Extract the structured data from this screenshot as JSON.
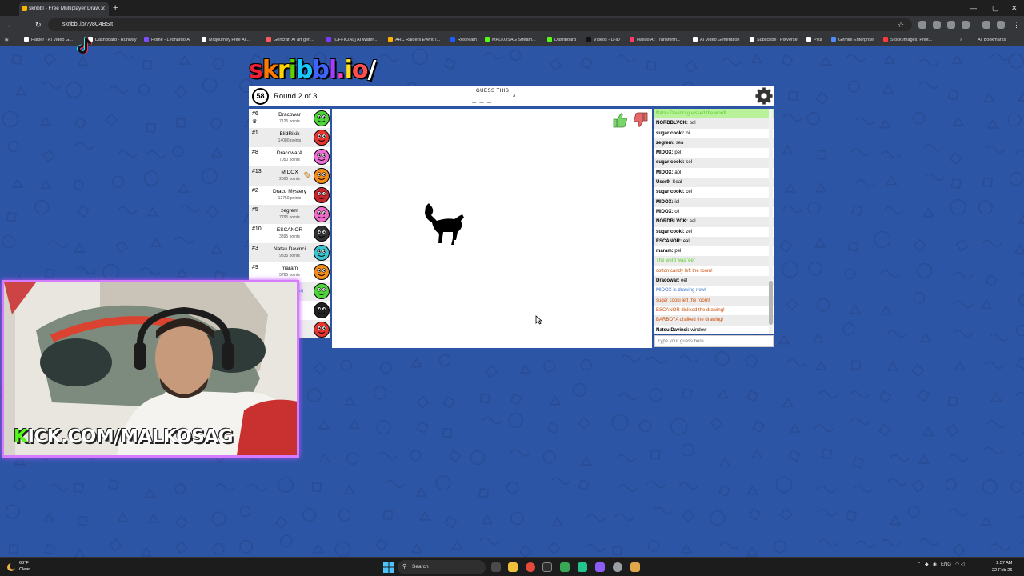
{
  "browser": {
    "tab_title": "skribbl - Free Multiplayer Draw...",
    "url": "skribbl.io/?y8C4BSIt",
    "bookmarks": [
      {
        "label": "Haiper - AI Video G...",
        "color": "#ffffff"
      },
      {
        "label": "Dashboard - Runway",
        "color": "#ffffff"
      },
      {
        "label": "Home - Leonardo.Ai",
        "color": "#7d4cff"
      },
      {
        "label": "Midjourney Free AI...",
        "color": "#ffffff"
      },
      {
        "label": "Gencraft AI art gen...",
        "color": "#ff5a5a"
      },
      {
        "label": "[OFFICIAL] AI Water...",
        "color": "#7a3cff"
      },
      {
        "label": "ARC Raiders Event T...",
        "color": "#ffb300"
      },
      {
        "label": "Restream",
        "color": "#1e5cff"
      },
      {
        "label": "MALKOSAG Stream...",
        "color": "#53fc18"
      },
      {
        "label": "Dashboard",
        "color": "#53fc18"
      },
      {
        "label": "Videos - D-ID",
        "color": "#111111"
      },
      {
        "label": "Hailuo AI: Transform...",
        "color": "#ff3a6b"
      },
      {
        "label": "AI Video Generation",
        "color": "#ffffff"
      },
      {
        "label": "Subscribe | PixVerse",
        "color": "#ffffff"
      },
      {
        "label": "Pika",
        "color": "#ffffff"
      },
      {
        "label": "Gemini Enterprise",
        "color": "#4f8cff"
      },
      {
        "label": "Stock Images, Phot...",
        "color": "#ff3a3a"
      }
    ],
    "all_bookmarks": "All Bookmarks"
  },
  "game": {
    "logo": "skribbl.io",
    "timer": "58",
    "round": "Round 2 of 3",
    "guess_label": "GUESS THIS",
    "guess_word": "_ _ _",
    "word_length": "3",
    "players": [
      {
        "rank": "#6",
        "name": "Dracowar",
        "points": "7125 points",
        "color": "#4fd43a",
        "crown": true
      },
      {
        "rank": "#1",
        "name": "BlidRikik",
        "points": "14080 points",
        "color": "#e9352f",
        "crown": false
      },
      {
        "rank": "#8",
        "name": "DracowarA",
        "points": "7050 points",
        "color": "#ef6bd6",
        "crown": false
      },
      {
        "rank": "#13",
        "name": "MIDOX",
        "points": "2500 points",
        "color": "#f58b19",
        "crown": false
      },
      {
        "rank": "#2",
        "name": "Draco Mystery",
        "points": "12750 points",
        "color": "#c6252b",
        "crown": false
      },
      {
        "rank": "#5",
        "name": "zegrem",
        "points": "7795 points",
        "color": "#f06bc7",
        "crown": false
      },
      {
        "rank": "#10",
        "name": "ESCANOR",
        "points": "3395 points",
        "color": "#333333",
        "crown": false
      },
      {
        "rank": "#3",
        "name": "Natsu Davinci",
        "points": "9835 points",
        "color": "#38c6d0",
        "crown": false
      },
      {
        "rank": "#9",
        "name": "maram",
        "points": "5765 points",
        "color": "#f58b19",
        "crown": false
      },
      {
        "rank": "",
        "name": "User9 (You)",
        "points": "",
        "color": "#4fd43a",
        "crown": false
      },
      {
        "rank": "",
        "name": "",
        "points": "",
        "color": "#222222",
        "crown": false
      },
      {
        "rank": "",
        "name": "",
        "points": "",
        "color": "#e9352f",
        "crown": false
      }
    ],
    "chat": [
      {
        "who": "",
        "text": "Natsu Davinci guessed the word!",
        "style": "greenbg"
      },
      {
        "who": "NORDBLVCK:",
        "text": "pol",
        "style": ""
      },
      {
        "who": "sugar cooki:",
        "text": "oil",
        "style": ""
      },
      {
        "who": "zegrem:",
        "text": "sea",
        "style": ""
      },
      {
        "who": "MIDOX:",
        "text": "pel",
        "style": ""
      },
      {
        "who": "sugar cooki:",
        "text": "sel",
        "style": ""
      },
      {
        "who": "MIDOX:",
        "text": "aol",
        "style": ""
      },
      {
        "who": "User9:",
        "text": "Seal",
        "style": ""
      },
      {
        "who": "sugar cooki:",
        "text": "cel",
        "style": ""
      },
      {
        "who": "MIDOX:",
        "text": "iol",
        "style": ""
      },
      {
        "who": "MIDOX:",
        "text": "oil",
        "style": ""
      },
      {
        "who": "NORDBLVCK:",
        "text": "eal",
        "style": ""
      },
      {
        "who": "sugar cooki:",
        "text": "zel",
        "style": ""
      },
      {
        "who": "ESCANOR:",
        "text": "eal",
        "style": ""
      },
      {
        "who": "maram:",
        "text": "pel",
        "style": ""
      },
      {
        "who": "",
        "text": "The word was 'eel'",
        "style": "green"
      },
      {
        "who": "",
        "text": "cotton candy left the room!",
        "style": "red"
      },
      {
        "who": "Dracowar:",
        "text": "eel",
        "style": ""
      },
      {
        "who": "",
        "text": "MIDOX is drawing now!",
        "style": "blue"
      },
      {
        "who": "",
        "text": "sugar cooki left the room!",
        "style": "red"
      },
      {
        "who": "",
        "text": "ESCANOR disliked the drawing!",
        "style": "red"
      },
      {
        "who": "",
        "text": "BARBO7A disliked the drawing!",
        "style": "red"
      },
      {
        "who": "Natsu Davinci:",
        "text": "window",
        "style": ""
      }
    ],
    "guess_placeholder": "Type your guess here..."
  },
  "stream": {
    "kick_prefix": "K",
    "kick_text": "ICK.COM/MALKOSAG"
  },
  "taskbar": {
    "temp": "68°F",
    "weather": "Clear",
    "search": "Search",
    "lang": "ENG",
    "time": "2:57 AM",
    "date": "22-Feb-26"
  }
}
